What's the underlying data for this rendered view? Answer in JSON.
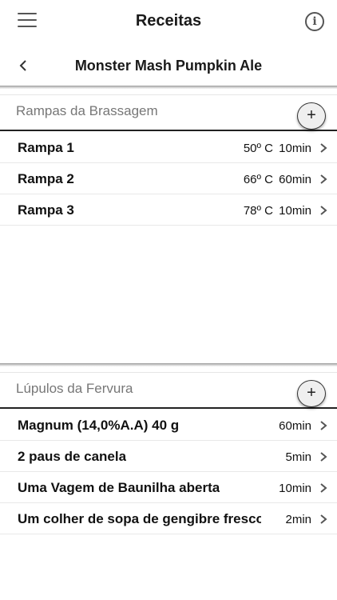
{
  "header": {
    "title": "Receitas",
    "menu_icon": "hamburger-menu-icon",
    "info_icon": "info-icon",
    "info_glyph": "i"
  },
  "recipe": {
    "title": "Monster Mash Pumpkin Ale",
    "back_icon": "chevron-left-icon"
  },
  "mash": {
    "title": "Rampas da Brassagem",
    "add_label": "+",
    "steps": [
      {
        "name": "Rampa 1",
        "temp": "50º C",
        "time": "10min"
      },
      {
        "name": "Rampa 2",
        "temp": "66º C",
        "time": "60min"
      },
      {
        "name": "Rampa 3",
        "temp": "78º C",
        "time": "10min"
      }
    ]
  },
  "boil": {
    "title": "Lúpulos da Fervura",
    "add_label": "+",
    "hops": [
      {
        "name": "Magnum (14,0%A.A) 40 g",
        "time": "60min"
      },
      {
        "name": "2 paus de canela",
        "time": "5min"
      },
      {
        "name": "Uma Vagem de Baunilha aberta",
        "time": "10min"
      },
      {
        "name": "Um colher de sopa de gengibre fresco",
        "time": "2min"
      }
    ]
  },
  "colors": {
    "text": "#111111",
    "muted": "#777777",
    "divider": "#222222"
  }
}
